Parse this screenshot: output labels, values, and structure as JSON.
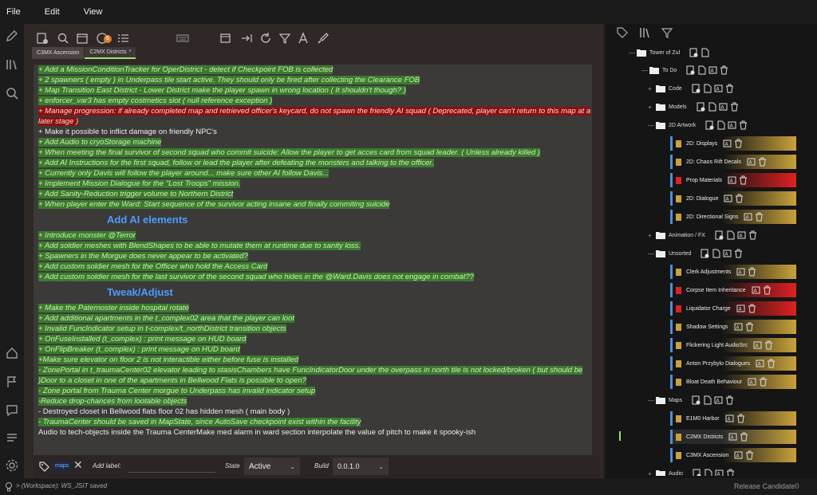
{
  "menu": {
    "file": "File",
    "edit": "Edit",
    "view": "View"
  },
  "toolbar": {
    "notification_count": "6"
  },
  "tabs": [
    {
      "label": "C3MX Ascension",
      "active": false
    },
    {
      "label": "C2MX Districts",
      "active": true,
      "modified_marker": "*"
    }
  ],
  "editor": {
    "lines": [
      {
        "kind": "g",
        "text": "+ Add a MissionConditionTracker for OperDistrict - detect if Checkpoint FOB is collected"
      },
      {
        "kind": "g",
        "text": "+ 2 spawners ( empty ) in Underpass tile start active. They should only be fired after collecting the Clearance FOB"
      },
      {
        "kind": "g",
        "text": "+ Map Transition East District - Lower District make the player spawn in wrong location ( It shouldn't though? )"
      },
      {
        "kind": "g",
        "text": "+ enforcer_var3 has empty costmetics slot ( null reference exception )"
      },
      {
        "kind": "r",
        "text": "+ Manage progression: if already completed map and retrieved officer's keycard, do not spawn the friendly AI squad              ( Deprecated, player can't return to this map at a later stage )"
      },
      {
        "kind": "n",
        "text": "+ Make it possible to inflict damage on friendly NPC's"
      },
      {
        "kind": "g",
        "text": "+ Add Audio to cryoStorage machine"
      },
      {
        "kind": "g",
        "text": "+ When meeting the final survivor of second squad who commit suicide: Allow the player to get acces card from squad leader. ( Unless already killed )"
      },
      {
        "kind": "g",
        "text": "+ Add AI Instructions for the first squad, follow or lead the player after defeating the monsters and talking to the officer."
      },
      {
        "kind": "g",
        "text": "+ Currently only Davis will follow the player around... make sure other AI follow Davis..."
      },
      {
        "kind": "g",
        "text": "+ Implement Mission Dialogue for the \"Lost Troops\" mission."
      },
      {
        "kind": "g",
        "text": "+ Add Sanity-Reduction trigger volume to Northern District"
      },
      {
        "kind": "g",
        "text": "+ When player enter the Ward: Start sequence of the survivor acting insane and finally commiting suicide"
      }
    ],
    "heading1": "Add AI elements",
    "lines2": [
      {
        "kind": "g",
        "text": "+ Introduce monster @Terror"
      },
      {
        "kind": "g",
        "text": "+ Add soldier meshes with BlendShapes to be able to mutate them at runtime due to sanity loss."
      },
      {
        "kind": "g",
        "text": "+ Spawners in the Morgue does never appear to be activated?"
      },
      {
        "kind": "g",
        "text": "+ Add custom soldier mesh for the Officer who hold the Access Card"
      },
      {
        "kind": "g",
        "text": "+ Add custom soldier mesh for the last survivor of the second squad who hides in the @Ward.Davis does not engage in combat??"
      }
    ],
    "heading2": "Tweak/Adjust",
    "lines3": [
      {
        "kind": "g",
        "text": "+ Make the Paternoster inside hospital rotate"
      },
      {
        "kind": "g",
        "text": "+ Add additional apartments in the t_complex02 area that the player can loot"
      },
      {
        "kind": "g",
        "text": "+ Invalid FuncIndicator setup in t-complex/t_northDistrict transition objects"
      },
      {
        "kind": "g",
        "text": "+ OnFuseInstalled (t_complex) : print message on HUD board"
      },
      {
        "kind": "g",
        "text": "+ OnFlipBreaker (t_complex) : print message on HUD board"
      },
      {
        "kind": "g",
        "text": "+Make sure elevator on floor 2 is not interactible either before fuse is installed"
      },
      {
        "kind": "gw",
        "text": "- ZonePortal in t_traumaCenter02 elevator leading to stasisChambers have FuncIndicatorDoor under the overpass in north tile is not locked/broken ( but should be )Door to a closet in one of the apartments in Bellwood Flats is possible to open?"
      },
      {
        "kind": "g",
        "text": "- Zone portal from Trauma Center morgue to Underpass has invalid indicator setup"
      },
      {
        "kind": "g",
        "text": "-Reduce drop-chances from lootable objects"
      },
      {
        "kind": "n",
        "text": "- Destroyed closet in Bellwood flats floor 02 has hidden mesh ( main body )"
      },
      {
        "kind": "g",
        "text": "- TraumaCenter should be saved in MapState, since AutoSave checkpoint exist within the facility"
      },
      {
        "kind": "n",
        "text": "Audio to tech-objects inside the Trauma CenterMake med alarm in ward section interpolate the value of pitch to make it spooky-ish"
      }
    ]
  },
  "bottom": {
    "tag_chip": "maps",
    "add_label": "Add label:",
    "state_label": "State",
    "state_value": "Active",
    "build_label": "Build",
    "build_value": "0.0.1.0"
  },
  "status": {
    "workspace_msg": "> (Workspace): WS_JSIT saved",
    "release": "Release Candidate0"
  },
  "tree": {
    "root": "Tower of Zul",
    "todo": "To Do",
    "code": "Code",
    "models": "Models",
    "artwork": "2D Artwork",
    "artwork_items": [
      {
        "label": "2D: Displays",
        "color": "#c8a23a"
      },
      {
        "label": "2D: Chaos Rift Decals",
        "color": "#c8a23a"
      },
      {
        "label": "Prop Materials",
        "color": "#e02020"
      },
      {
        "label": "2D: Dialogue",
        "color": "#c8a23a"
      },
      {
        "label": "2D: Directional Signs",
        "color": "#c8a23a"
      }
    ],
    "animation": "Animation / FX",
    "unsorted": "Unsorted",
    "unsorted_items": [
      {
        "label": "Clerk Adjustments",
        "color": "#c8a23a"
      },
      {
        "label": "Corpse Item Inheritance",
        "color": "#e02020"
      },
      {
        "label": "Liquidator Charge",
        "color": "#e02020"
      },
      {
        "label": "Shadow Settings",
        "color": "#c8a23a"
      },
      {
        "label": "Flickering Light AudioSrc",
        "color": "#c8a23a"
      },
      {
        "label": "Anton Przybylo Dialogues",
        "color": "#c8a23a"
      },
      {
        "label": "Bloat Death Behaviour",
        "color": "#c8a23a"
      }
    ],
    "maps": "Maps",
    "maps_items": [
      {
        "label": "E1M0 Harbor",
        "color": "#c8a23a"
      },
      {
        "label": "C2MX Districts",
        "color": "#c8a23a"
      },
      {
        "label": "C3MX Ascension",
        "color": "#c8a23a"
      }
    ],
    "audio": "Audio"
  },
  "colors": {
    "accent_green": "#9be06b",
    "done_green": "#3c7a2e",
    "deprecated_red": "#8c1010",
    "heading_blue": "#4a9dff"
  }
}
